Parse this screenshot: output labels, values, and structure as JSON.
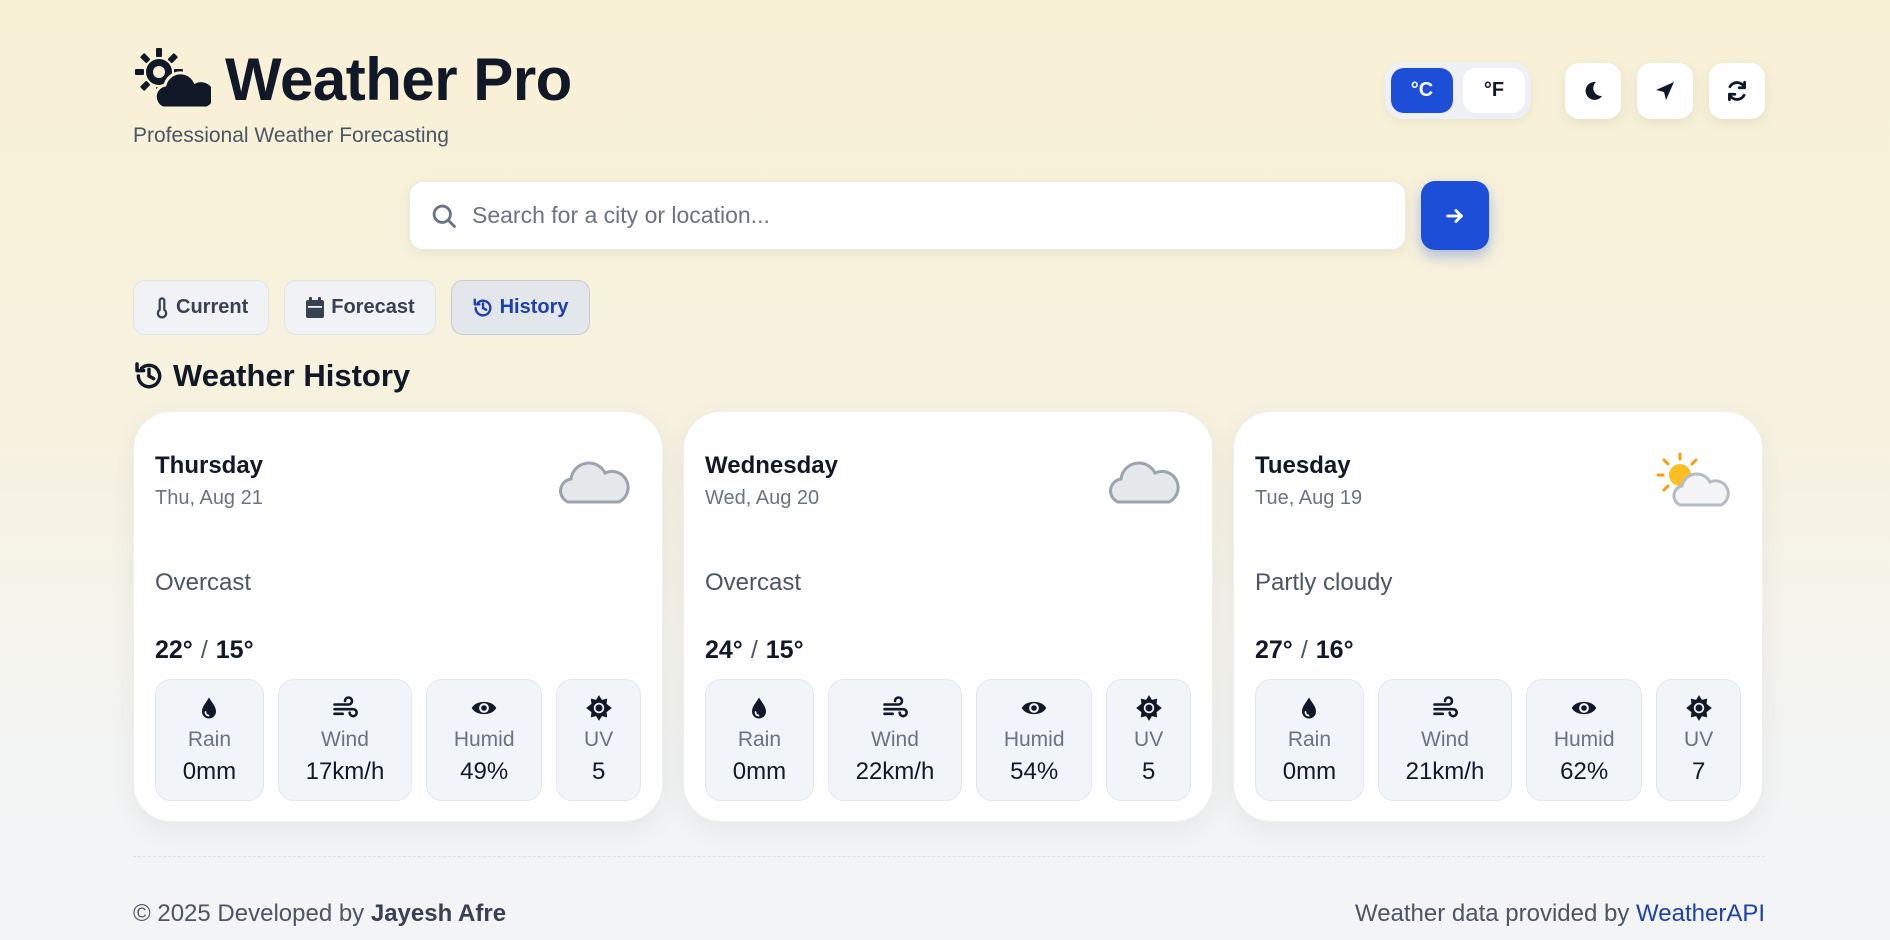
{
  "brand": {
    "title": "Weather Pro",
    "subtitle": "Professional Weather Forecasting"
  },
  "controls": {
    "celsius_label": "°C",
    "fahrenheit_label": "°F",
    "active_unit": "°C"
  },
  "search": {
    "placeholder": "Search for a city or location...",
    "value": ""
  },
  "tabs": [
    {
      "label": "Current",
      "icon": "thermometer-icon",
      "active": false
    },
    {
      "label": "Forecast",
      "icon": "calendar-icon",
      "active": false
    },
    {
      "label": "History",
      "icon": "history-icon",
      "active": true
    }
  ],
  "section": {
    "title": "Weather History"
  },
  "cards": [
    {
      "day": "Thursday",
      "date": "Thu, Aug 21",
      "icon": "cloud-icon",
      "condition": "Overcast",
      "high": "22°",
      "sep": "/",
      "low": "15°",
      "stats": [
        {
          "label": "Rain",
          "value": "0mm",
          "icon": "droplet-icon"
        },
        {
          "label": "Wind",
          "value": "17km/h",
          "icon": "wind-icon"
        },
        {
          "label": "Humid",
          "value": "49%",
          "icon": "eye-icon"
        },
        {
          "label": "UV",
          "value": "5",
          "icon": "sun-icon"
        }
      ]
    },
    {
      "day": "Wednesday",
      "date": "Wed, Aug 20",
      "icon": "cloud-icon",
      "condition": "Overcast",
      "high": "24°",
      "sep": "/",
      "low": "15°",
      "stats": [
        {
          "label": "Rain",
          "value": "0mm",
          "icon": "droplet-icon"
        },
        {
          "label": "Wind",
          "value": "22km/h",
          "icon": "wind-icon"
        },
        {
          "label": "Humid",
          "value": "54%",
          "icon": "eye-icon"
        },
        {
          "label": "UV",
          "value": "5",
          "icon": "sun-icon"
        }
      ]
    },
    {
      "day": "Tuesday",
      "date": "Tue, Aug 19",
      "icon": "partly-cloudy-icon",
      "condition": "Partly cloudy",
      "high": "27°",
      "sep": "/",
      "low": "16°",
      "stats": [
        {
          "label": "Rain",
          "value": "0mm",
          "icon": "droplet-icon"
        },
        {
          "label": "Wind",
          "value": "21km/h",
          "icon": "wind-icon"
        },
        {
          "label": "Humid",
          "value": "62%",
          "icon": "eye-icon"
        },
        {
          "label": "UV",
          "value": "7",
          "icon": "sun-icon"
        }
      ]
    }
  ],
  "footer": {
    "copyright": "© 2025 Developed by",
    "author": "Jayesh Afre",
    "provider_text": "Weather data provided by",
    "provider_link": "WeatherAPI"
  },
  "colors": {
    "accent": "#1d4ed8",
    "text": "#111827",
    "muted": "#6b7280"
  }
}
